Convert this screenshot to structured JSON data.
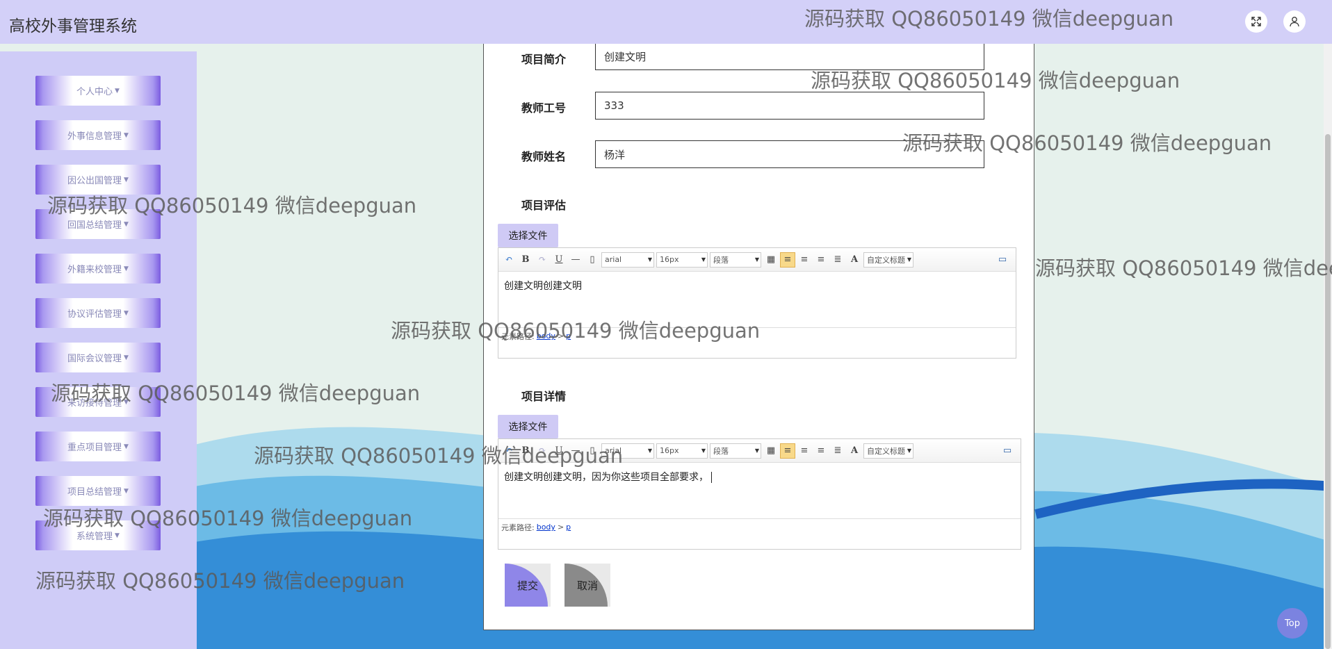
{
  "header": {
    "title": "高校外事管理系统"
  },
  "sidebar": {
    "items": [
      {
        "label": "个人中心"
      },
      {
        "label": "外事信息管理"
      },
      {
        "label": "因公出国管理"
      },
      {
        "label": "回国总结管理"
      },
      {
        "label": "外籍来校管理"
      },
      {
        "label": "协议评估管理"
      },
      {
        "label": "国际会议管理"
      },
      {
        "label": "来访接待管理"
      },
      {
        "label": "重点项目管理"
      },
      {
        "label": "项目总结管理"
      },
      {
        "label": "系统管理"
      }
    ]
  },
  "form": {
    "summary_label": "项目简介",
    "summary_value": "创建文明",
    "teacher_id_label": "教师工号",
    "teacher_id_value": "333",
    "teacher_name_label": "教师姓名",
    "teacher_name_value": "杨洋",
    "evaluation_label": "项目评估",
    "details_label": "项目详情",
    "file_button": "选择文件",
    "submit": "提交",
    "cancel": "取消"
  },
  "editor1": {
    "font": "arial",
    "size": "16px",
    "paragraph": "段落",
    "custom_title": "自定义标题",
    "content": "创建文明创建文明",
    "path_label": "元素路径:",
    "path_body": "body",
    "path_p": "p"
  },
  "editor2": {
    "font": "arial",
    "size": "16px",
    "paragraph": "段落",
    "custom_title": "自定义标题",
    "content": "创建文明创建文明，因为你这些项目全部要求，",
    "path_label": "元素路径:",
    "path_body": "body",
    "path_p": "p"
  },
  "top_button": "Top",
  "watermark": "源码获取 QQ86050149 微信deepguan",
  "colors": {
    "topbar": "#d3d0f8",
    "sidebar": "#cfccf7",
    "menu_accent": "#7b5ce0",
    "submit_accent": "#8f86e8",
    "cancel_accent": "#8a8a8a"
  }
}
